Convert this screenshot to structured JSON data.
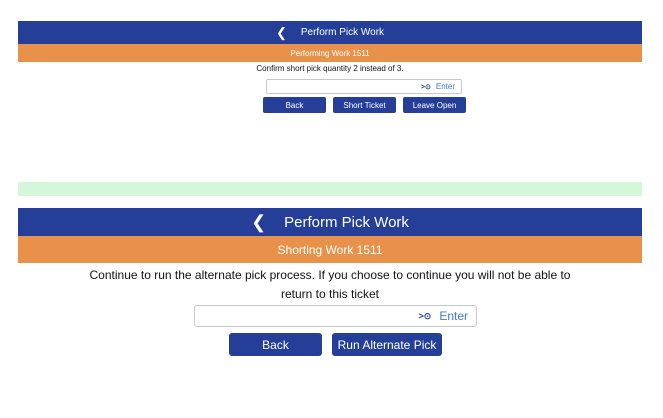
{
  "top_screen": {
    "header_title": "Perform Pick Work",
    "subheader": "Performing Work 1511",
    "message": "Confirm short pick quantity 2 instead of 3.",
    "input": {
      "value": "",
      "placeholder": "",
      "scan_icon": ">⊙",
      "enter_label": "Enter"
    },
    "buttons": {
      "back": "Back",
      "short_ticket": "Short Ticket",
      "leave_open": "Leave Open"
    }
  },
  "bottom_screen": {
    "header_title": "Perform Pick Work",
    "subheader": "Shorting Work 1511",
    "message": "Continue to run the alternate pick process. If you choose to continue you will not be able to return to this ticket",
    "input": {
      "value": "",
      "placeholder": "",
      "scan_icon": ">⊙",
      "enter_label": "Enter"
    },
    "buttons": {
      "back": "Back",
      "run_alternate_pick": "Run Alternate Pick"
    }
  },
  "colors": {
    "header_blue": "#253f98",
    "subheader_orange": "#e8914a",
    "divider_green": "#d4f7da",
    "enter_blue": "#3b7ad6"
  },
  "icons": {
    "back": "chevron-left-icon",
    "scan": "scan-icon"
  }
}
